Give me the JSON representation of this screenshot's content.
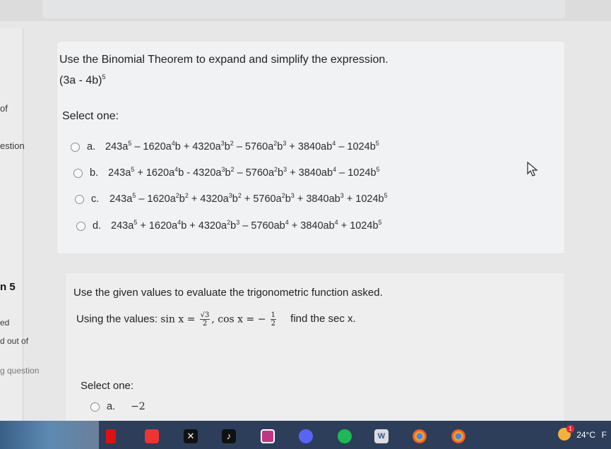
{
  "sidebar": {
    "of": "of",
    "estion": "estion",
    "q5": "n 5",
    "ed": "ed",
    "out_of": "d out of",
    "question": "g question"
  },
  "q1": {
    "prompt": "Use the Binomial Theorem to expand and simplify the expression.",
    "expression": "(3a - 4b)",
    "expression_exp": "5",
    "select_one": "Select one:",
    "options": [
      {
        "letter": "a."
      },
      {
        "letter": "b."
      },
      {
        "letter": "c."
      },
      {
        "letter": "d."
      }
    ]
  },
  "q2": {
    "prompt": "Use the given values to evaluate the trigonometric function asked.",
    "values_prefix": "Using the values:",
    "sin_lhs": "sin x =",
    "sin_num": "√3",
    "sin_den": "2",
    "cos_lhs": ", cos x = −",
    "cos_num": "1",
    "cos_den": "2",
    "find": "find the sec x.",
    "select_one": "Select one:",
    "option_a_letter": "a.",
    "option_a_value": "−2"
  },
  "taskbar": {
    "weather": "24°C",
    "badge": "1",
    "trailing": "F",
    "word_icon": "W",
    "icons": [
      "windows-icon",
      "netflix-icon",
      "youtube-icon",
      "x-icon",
      "tiktok-icon",
      "instagram-icon",
      "discord-icon",
      "spotify-icon",
      "word-icon",
      "chrome-icon",
      "chrome-icon-2"
    ]
  }
}
